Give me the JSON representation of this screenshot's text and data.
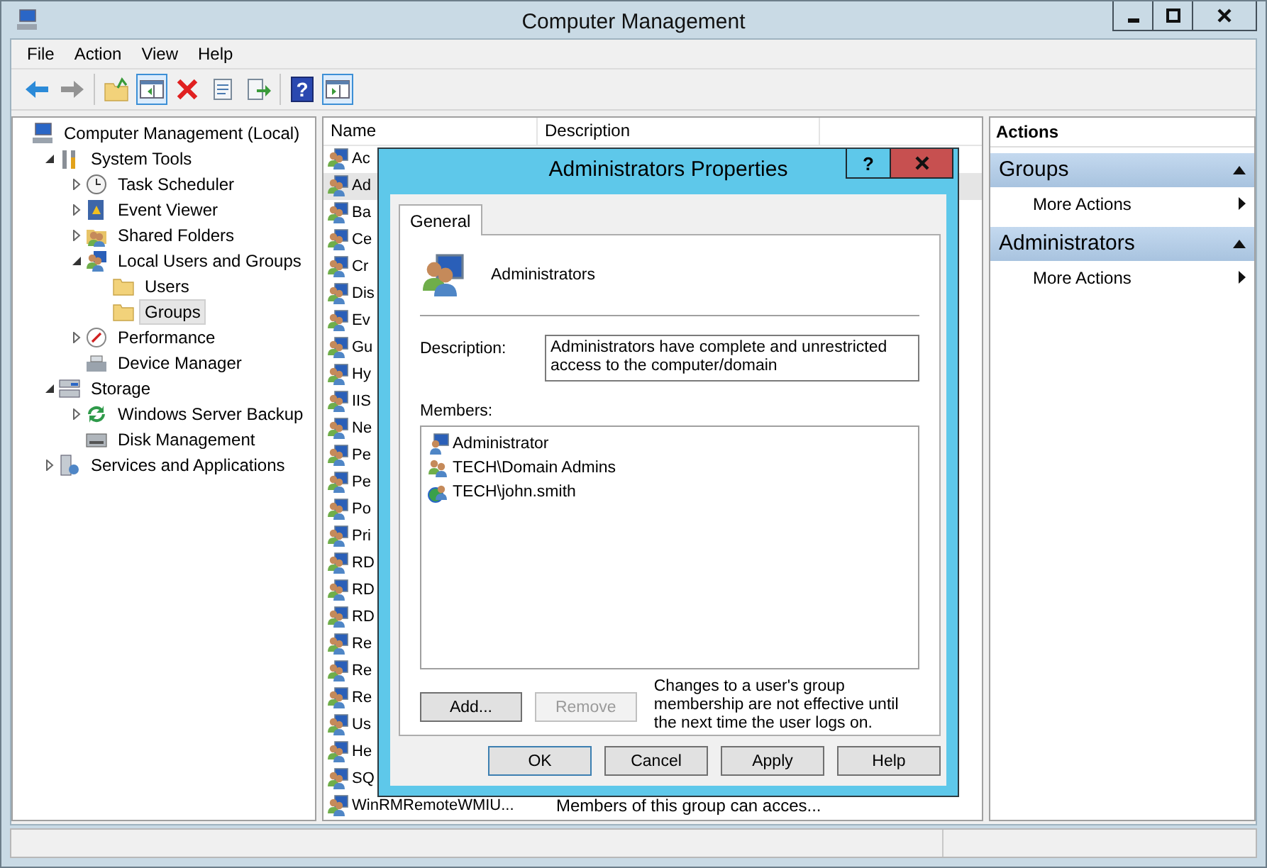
{
  "window": {
    "title": "Computer Management"
  },
  "menu": [
    "File",
    "Action",
    "View",
    "Help"
  ],
  "toolbar": [
    [
      {
        "kind": "back",
        "disabled": false,
        "on": false
      },
      {
        "kind": "forward",
        "disabled": true,
        "on": false
      }
    ],
    [
      {
        "kind": "up",
        "disabled": false,
        "on": false
      },
      {
        "kind": "tree-pane",
        "disabled": false,
        "on": true
      },
      {
        "kind": "delete",
        "disabled": false,
        "on": false
      },
      {
        "kind": "properties",
        "disabled": false,
        "on": false
      },
      {
        "kind": "export",
        "disabled": false,
        "on": false
      }
    ],
    [
      {
        "kind": "help",
        "label": "?",
        "disabled": false,
        "on": false
      },
      {
        "kind": "action-pane",
        "disabled": false,
        "on": true
      }
    ]
  ],
  "tree": [
    {
      "label": "Computer Management (Local)",
      "kind": "computer",
      "selected": false,
      "children": [
        {
          "label": "System Tools",
          "kind": "tools",
          "expanded": true,
          "selected": false,
          "children": [
            {
              "label": "Task Scheduler",
              "kind": "clock",
              "expanded": false,
              "selected": false
            },
            {
              "label": "Event Viewer",
              "kind": "log",
              "expanded": false,
              "selected": false
            },
            {
              "label": "Shared Folders",
              "kind": "shared",
              "expanded": false,
              "selected": false
            },
            {
              "label": "Local Users and Groups",
              "kind": "users",
              "expanded": true,
              "selected": false,
              "children": [
                {
                  "label": "Users",
                  "kind": "folder",
                  "selected": false
                },
                {
                  "label": "Groups",
                  "kind": "folder",
                  "selected": true
                }
              ]
            },
            {
              "label": "Performance",
              "kind": "gauge",
              "expanded": false,
              "selected": false
            },
            {
              "label": "Device Manager",
              "kind": "device",
              "selected": false
            }
          ]
        },
        {
          "label": "Storage",
          "kind": "storage",
          "expanded": true,
          "selected": false,
          "children": [
            {
              "label": "Windows Server Backup",
              "kind": "backup",
              "expanded": false,
              "selected": false
            },
            {
              "label": "Disk Management",
              "kind": "disk",
              "selected": false
            }
          ]
        },
        {
          "label": "Services and Applications",
          "kind": "services",
          "expanded": false,
          "selected": false
        }
      ]
    }
  ],
  "list": {
    "columns": [
      "Name",
      "Description"
    ],
    "rows": [
      {
        "name": "Ac",
        "selected": false
      },
      {
        "name": "Ad",
        "selected": true
      },
      {
        "name": "Ba",
        "selected": false
      },
      {
        "name": "Ce",
        "selected": false
      },
      {
        "name": "Cr",
        "selected": false
      },
      {
        "name": "Dis",
        "selected": false
      },
      {
        "name": "Ev",
        "selected": false
      },
      {
        "name": "Gu",
        "selected": false
      },
      {
        "name": "Hy",
        "selected": false
      },
      {
        "name": "IIS",
        "selected": false
      },
      {
        "name": "Ne",
        "selected": false
      },
      {
        "name": "Pe",
        "selected": false
      },
      {
        "name": "Pe",
        "selected": false
      },
      {
        "name": "Po",
        "selected": false
      },
      {
        "name": "Pri",
        "selected": false
      },
      {
        "name": "RD",
        "selected": false
      },
      {
        "name": "RD",
        "selected": false
      },
      {
        "name": "RD",
        "selected": false
      },
      {
        "name": "Re",
        "selected": false
      },
      {
        "name": "Re",
        "selected": false
      },
      {
        "name": "Re",
        "selected": false
      },
      {
        "name": "Us",
        "selected": false
      },
      {
        "name": "He",
        "selected": false
      },
      {
        "name": "SQ",
        "selected": false
      },
      {
        "name": "WinRMRemoteWMIU...",
        "description": "Members of this group can acces...",
        "selected": false
      }
    ]
  },
  "actions": {
    "title": "Actions",
    "sections": [
      {
        "title": "Groups",
        "items": [
          "More Actions"
        ]
      },
      {
        "title": "Administrators",
        "items": [
          "More Actions"
        ]
      }
    ]
  },
  "dialog": {
    "title": "Administrators Properties",
    "help_button": "?",
    "tabs": [
      {
        "label": "General",
        "selected": true
      }
    ],
    "group_name": "Administrators",
    "description_label": "Description:",
    "description": "Administrators have complete and unrestricted access to the computer/domain",
    "members_label": "Members:",
    "members": [
      {
        "name": "Administrator",
        "kind": "user"
      },
      {
        "name": "TECH\\Domain Admins",
        "kind": "group"
      },
      {
        "name": "TECH\\john.smith",
        "kind": "domain-user"
      }
    ],
    "member_buttons": [
      {
        "label": "Add...",
        "disabled": false
      },
      {
        "label": "Remove",
        "disabled": true
      }
    ],
    "note": "Changes to a user's group membership are not effective until the next time the user logs on.",
    "buttons": [
      {
        "label": "OK",
        "default": true
      },
      {
        "label": "Cancel",
        "default": false
      },
      {
        "label": "Apply",
        "default": false
      },
      {
        "label": "Help",
        "default": false
      }
    ]
  }
}
